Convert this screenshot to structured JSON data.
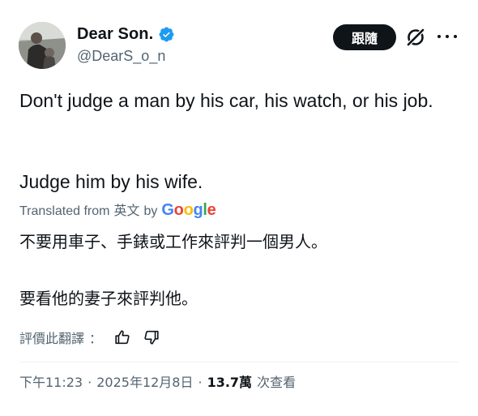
{
  "author": {
    "display_name": "Dear Son.",
    "handle": "@DearS_o_n",
    "verified": true
  },
  "header": {
    "follow_label": "跟隨",
    "icons": [
      "grok-icon",
      "more-icon"
    ]
  },
  "tweet": {
    "paragraph_1": "Don't judge a man by his car, his watch, or his job.",
    "paragraph_2": "Judge him by his wife."
  },
  "translation": {
    "label": "Translated from",
    "language": "英文",
    "by": "by",
    "provider": "Google",
    "line_1": "不要用車子、手錶或工作來評判一個男人。",
    "line_2": "要看他的妻子來評判他。"
  },
  "rate": {
    "label": "評價此翻譯",
    "colon": "：",
    "icons": [
      "thumbs-up-icon",
      "thumbs-down-icon"
    ]
  },
  "meta": {
    "time": "下午11:23",
    "separator": "·",
    "date": "2025年12月8日",
    "views_count": "13.7萬",
    "views_label": "次查看"
  },
  "colors": {
    "text": "#0f1419",
    "secondary": "#536471",
    "verified_blue": "#1d9bf0",
    "follow_bg": "#0f1419",
    "google_blue": "#4285f4",
    "google_red": "#ea4335",
    "google_yellow": "#fbbc05",
    "google_green": "#34a853"
  }
}
